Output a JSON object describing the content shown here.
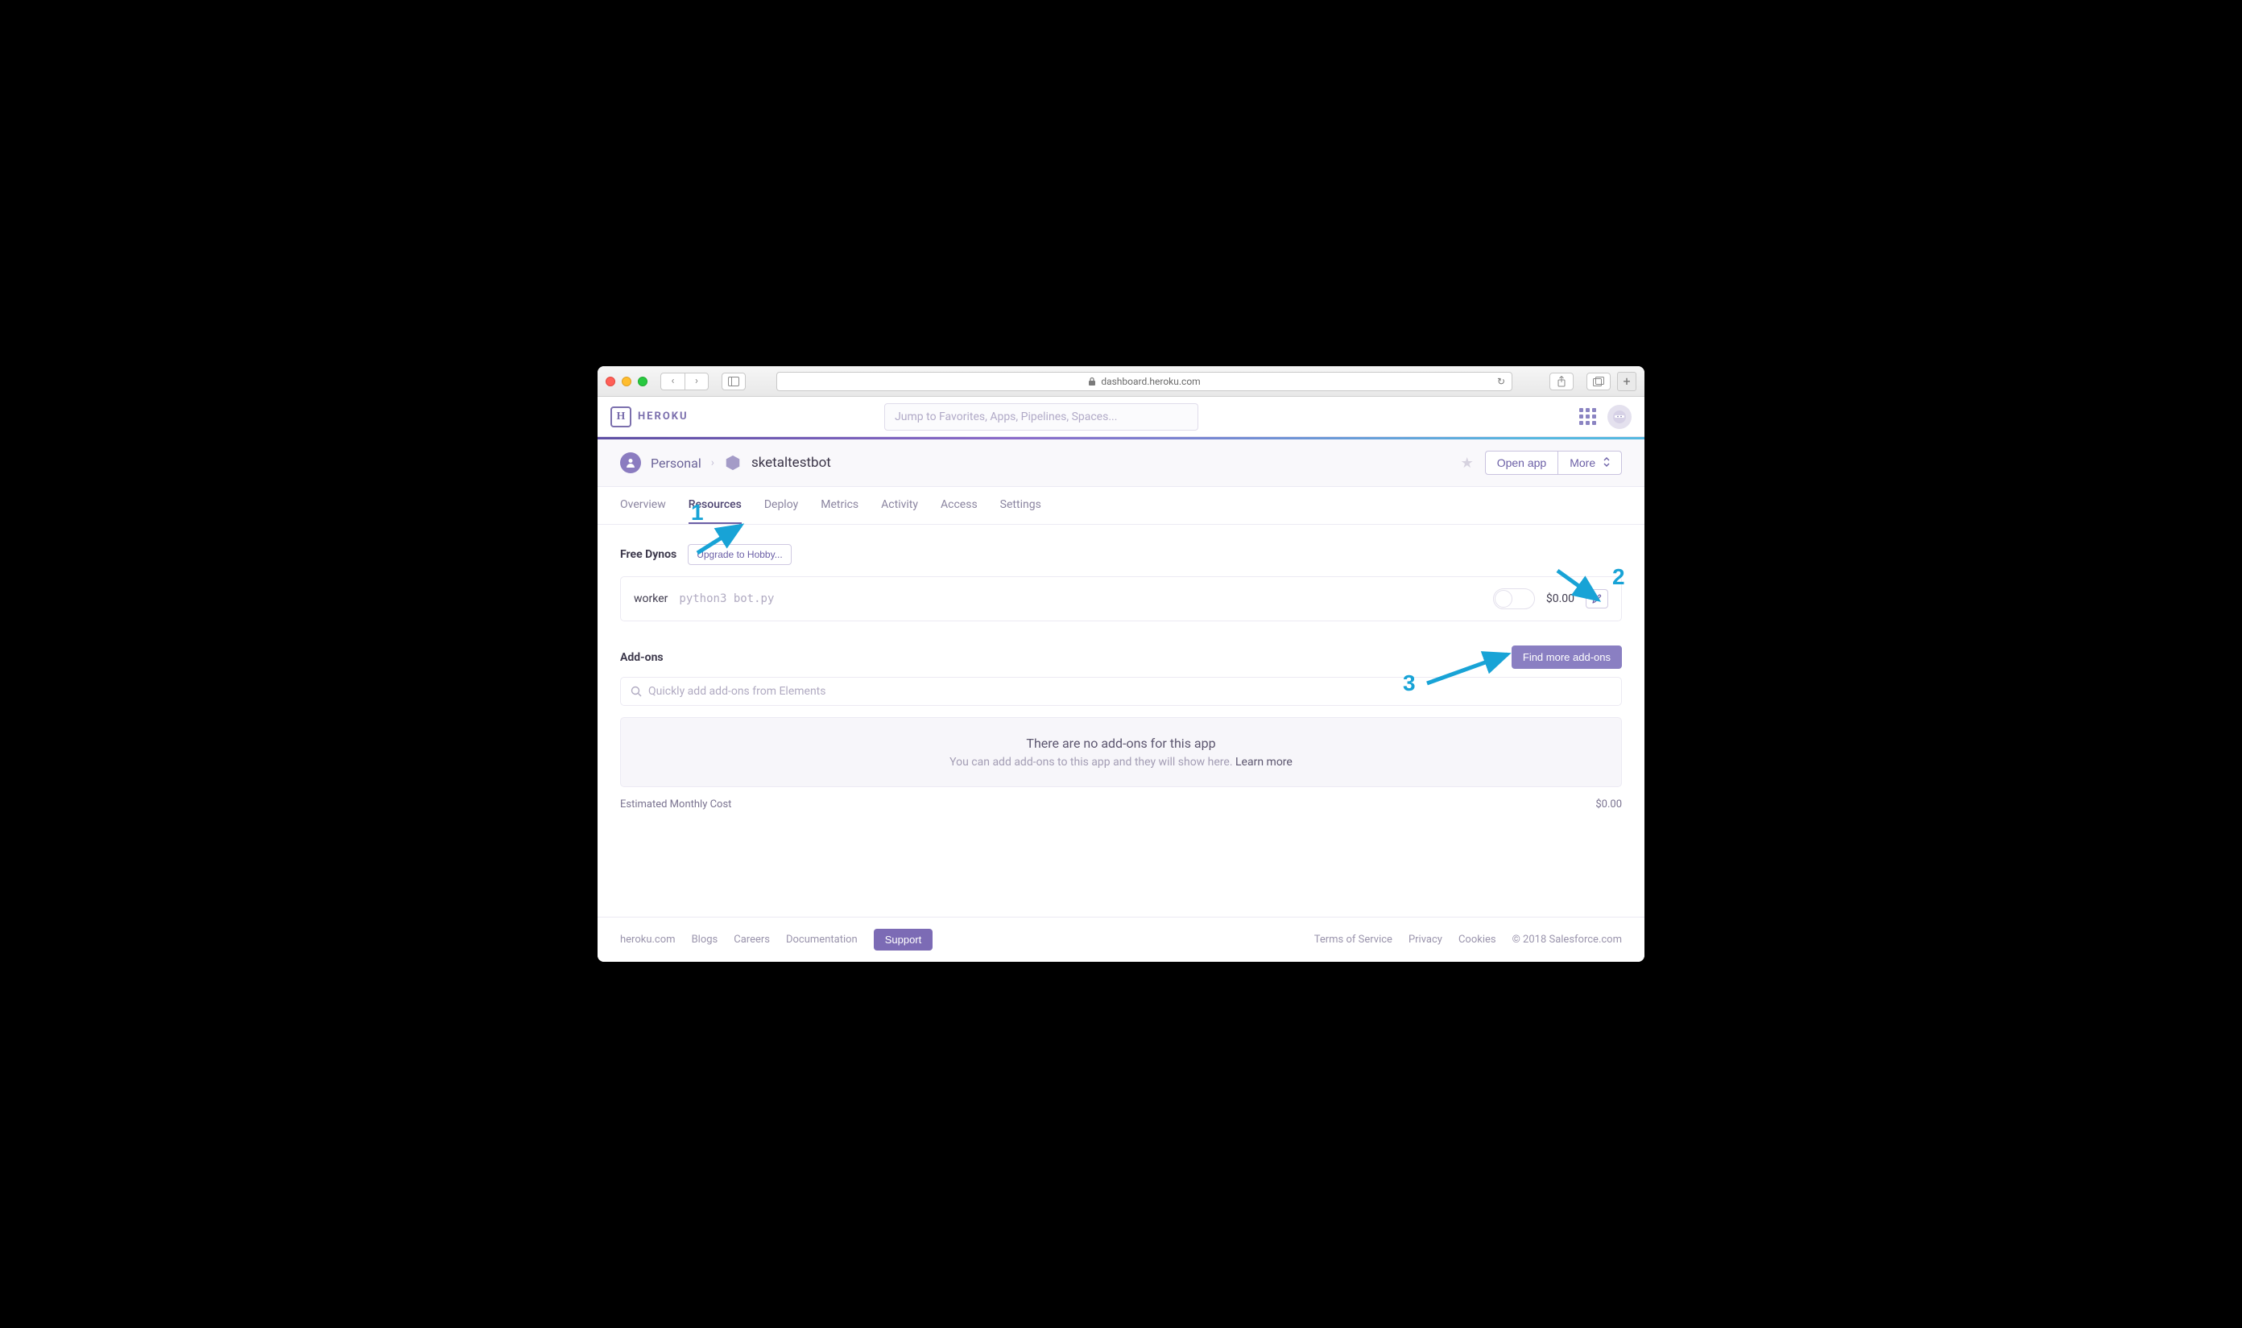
{
  "browser": {
    "url_host": "dashboard.heroku.com"
  },
  "header": {
    "brand": "HEROKU",
    "search_placeholder": "Jump to Favorites, Apps, Pipelines, Spaces..."
  },
  "breadcrumb": {
    "account": "Personal",
    "app": "sketaltestbot"
  },
  "actions": {
    "open_app": "Open app",
    "more": "More"
  },
  "tabs": [
    "Overview",
    "Resources",
    "Deploy",
    "Metrics",
    "Activity",
    "Access",
    "Settings"
  ],
  "active_tab": "Resources",
  "dynos": {
    "section": "Free Dynos",
    "upgrade": "Upgrade to Hobby...",
    "rows": [
      {
        "type": "worker",
        "command": "python3 bot.py",
        "price": "$0.00",
        "enabled": false
      }
    ]
  },
  "addons": {
    "section": "Add-ons",
    "find_more": "Find more add-ons",
    "search_placeholder": "Quickly add add-ons from Elements",
    "empty_title": "There are no add-ons for this app",
    "empty_sub_prefix": "You can add add-ons to this app and they will show here. ",
    "empty_link": "Learn more"
  },
  "estimate": {
    "label": "Estimated Monthly Cost",
    "value": "$0.00"
  },
  "footer": {
    "links_left": [
      "heroku.com",
      "Blogs",
      "Careers",
      "Documentation"
    ],
    "support": "Support",
    "links_right": [
      "Terms of Service",
      "Privacy",
      "Cookies"
    ],
    "copyright": "© 2018 Salesforce.com"
  },
  "annotations": {
    "one": "1",
    "two": "2",
    "three": "3"
  }
}
